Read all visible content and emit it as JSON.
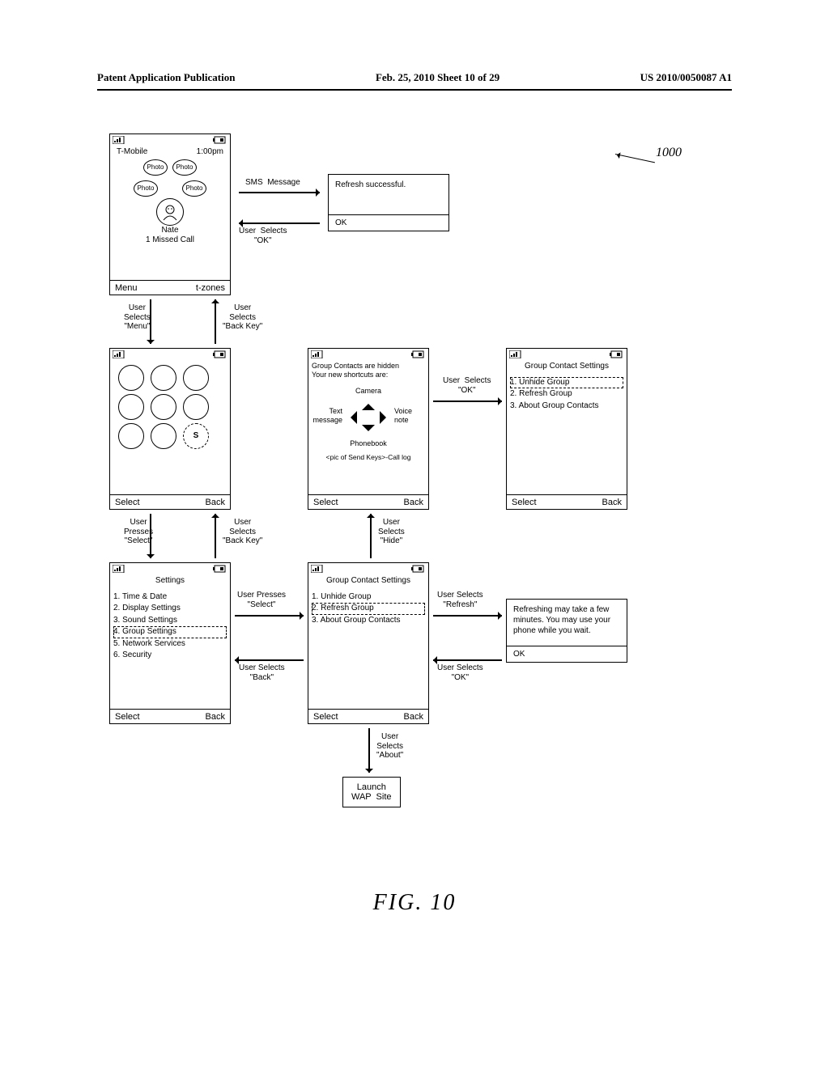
{
  "header": {
    "left": "Patent Application Publication",
    "center": "Feb. 25, 2010  Sheet 10 of 29",
    "right": "US 2010/0050087 A1"
  },
  "figure_ref": "1000",
  "figure_caption": "FIG.  10",
  "home": {
    "carrier": "T-Mobile",
    "time": "1:00pm",
    "photo_label": "Photo",
    "contact_name": "Nate",
    "contact_sub": "1  Missed  Call",
    "left_soft": "Menu",
    "right_soft": "t-zones"
  },
  "flow": {
    "sms_msg": "SMS  Message",
    "user_ok_back": "User  Selects\n\"OK\"",
    "user_menu": "User\nSelects\n\"Menu\"",
    "user_backkey1": "User\nSelects\n\"Back Key\"",
    "user_ok_fwd": "User  Selects\n\"OK\"",
    "user_press_select": "User\nPresses\n\"Select\"",
    "user_backkey2": "User\nSelects\n\"Back Key\"",
    "user_hide": "User\nSelects\n\"Hide\"",
    "user_press_select2": "User Presses\n\"Select\"",
    "user_back": "User Selects\n\"Back\"",
    "user_refresh": "User Selects\n\"Refresh\"",
    "user_ok2": "User Selects\n\"OK\"",
    "user_about": "User\nSelects\n\"About\""
  },
  "popup_refresh_ok": {
    "text": "Refresh successful.",
    "btn": "OK"
  },
  "popup_refresh_wait": {
    "text": "Refreshing may take a few minutes. You may use your phone while you wait.",
    "btn": "OK"
  },
  "menu_screen": {
    "left_soft": "Select",
    "right_soft": "Back",
    "s_letter": "S"
  },
  "shortcuts_screen": {
    "line1": "Group Contacts are hidden",
    "line2": "Your new shortcuts are:",
    "up": "Camera",
    "left": "Text\nmessage",
    "right": "Voice\nnote",
    "down": "Phonebook",
    "send": "<pic of Send Keys>-Call log",
    "left_soft": "Select",
    "right_soft": "Back"
  },
  "group_settings_top": {
    "title": "Group Contact Settings",
    "items": [
      "1. Unhide Group",
      "2. Refresh Group",
      "3. About Group Contacts"
    ],
    "left_soft": "Select",
    "right_soft": "Back"
  },
  "settings_screen": {
    "title": "Settings",
    "items": [
      "1. Time  &  Date",
      "2. Display Settings",
      "3. Sound Settings",
      "4. Group Settings",
      "5. Network Services",
      "6. Security"
    ],
    "highlight_index": 3,
    "left_soft": "Select",
    "right_soft": "Back"
  },
  "group_settings_bottom": {
    "title": "Group Contact Settings",
    "items": [
      "1. Unhide Group",
      "2. Refresh Group",
      "3. About Group Contacts"
    ],
    "highlight_index": 1,
    "left_soft": "Select",
    "right_soft": "Back"
  },
  "wap_box": "Launch\nWAP  Site"
}
